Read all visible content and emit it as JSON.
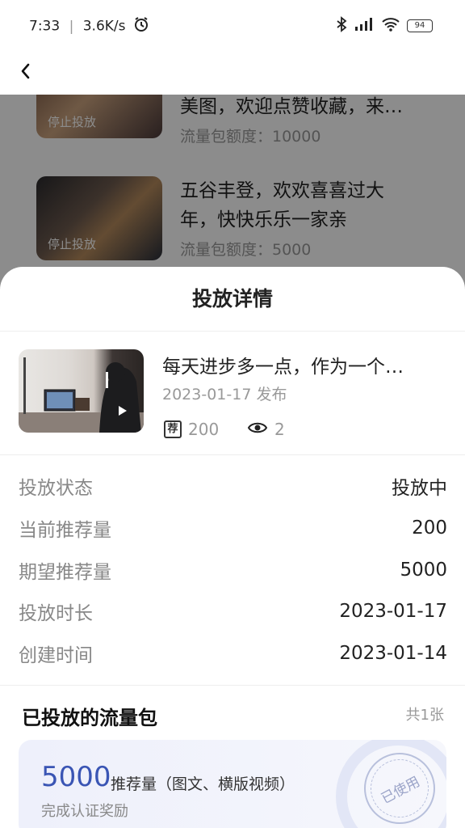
{
  "status_bar": {
    "time": "7:33",
    "network_speed": "3.6K/s",
    "battery": "94"
  },
  "background_list": [
    {
      "stop_label": "停止投放",
      "title": "美图，欢迎点赞收藏，来…",
      "meta": "流量包额度：10000"
    },
    {
      "stop_label": "停止投放",
      "title_line1": "五谷丰登，欢欢喜喜过大",
      "title_line2": "年，快快乐乐一家亲",
      "meta": "流量包额度：5000"
    }
  ],
  "sheet": {
    "title": "投放详情",
    "video": {
      "title": "每天进步多一点，作为一个…",
      "date": "2023-01-17 发布",
      "rec_icon_text": "荐",
      "recommend_count": "200",
      "view_count": "2"
    },
    "details": [
      {
        "label": "投放状态",
        "value": "投放中"
      },
      {
        "label": "当前推荐量",
        "value": "200"
      },
      {
        "label": "期望推荐量",
        "value": "5000"
      },
      {
        "label": "投放时长",
        "value": "2023-01-17"
      },
      {
        "label": "创建时间",
        "value": "2023-01-14"
      }
    ],
    "packs": {
      "header": "已投放的流量包",
      "total": "共1张",
      "items": [
        {
          "amount": "5000",
          "desc": "推荐量（图文、横版视频）",
          "reward": "完成认证奖励",
          "stamp": "已使用"
        }
      ]
    }
  }
}
